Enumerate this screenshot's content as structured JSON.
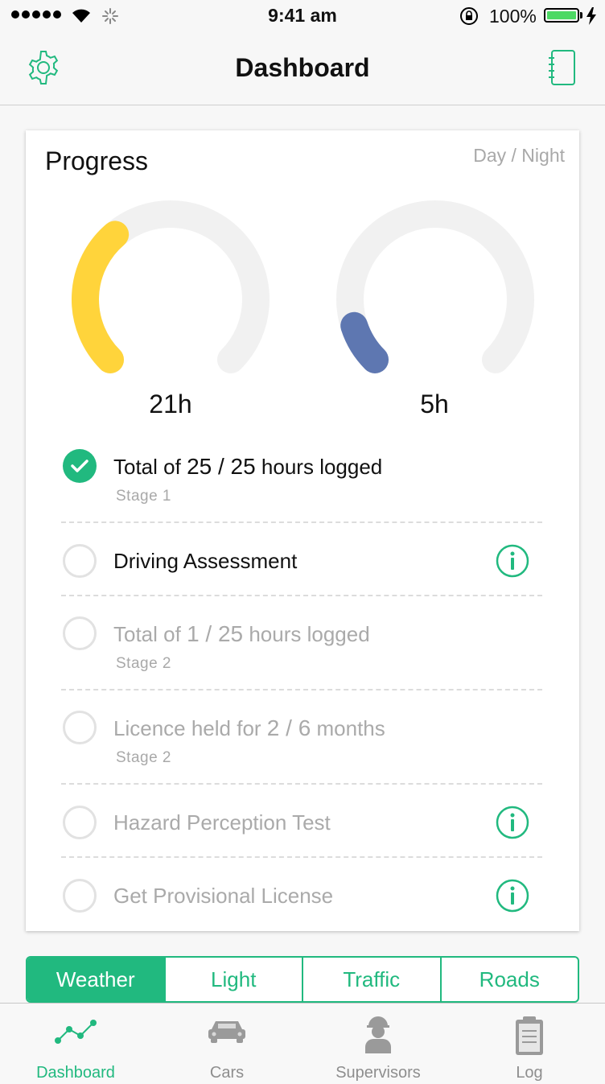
{
  "status_bar": {
    "time": "9:41 am",
    "battery": "100%"
  },
  "nav": {
    "title": "Dashboard"
  },
  "progress": {
    "title": "Progress",
    "toggle_label": "Day / Night",
    "day_gauge": {
      "label": "21h",
      "fraction": 0.35,
      "color": "#ffd43b"
    },
    "night_gauge": {
      "label": "5h",
      "fraction": 0.1,
      "color": "#5e77b1"
    }
  },
  "checklist": [
    {
      "prefix": "Total of ",
      "value": "25 / 25",
      "suffix": " hours logged",
      "sub": "Stage 1",
      "done": true
    },
    {
      "text": "Driving Assessment",
      "done": false,
      "info": true
    },
    {
      "prefix": "Total of ",
      "value": "1 / 25",
      "suffix": " hours logged",
      "sub": "Stage 2",
      "done": false
    },
    {
      "prefix": "Licence held for ",
      "value": "2 / 6",
      "suffix": " months",
      "sub": "Stage 2",
      "done": false
    },
    {
      "text": "Hazard Perception Test",
      "done": false,
      "info": true
    },
    {
      "text": "Get Provisional License",
      "done": false,
      "info": true
    }
  ],
  "segments": [
    "Weather",
    "Light",
    "Traffic",
    "Roads"
  ],
  "tabs": [
    "Dashboard",
    "Cars",
    "Supervisors",
    "Log"
  ],
  "colors": {
    "accent": "#21b97f",
    "day": "#ffd43b",
    "night": "#5e77b1",
    "track": "#f1f1f1"
  }
}
